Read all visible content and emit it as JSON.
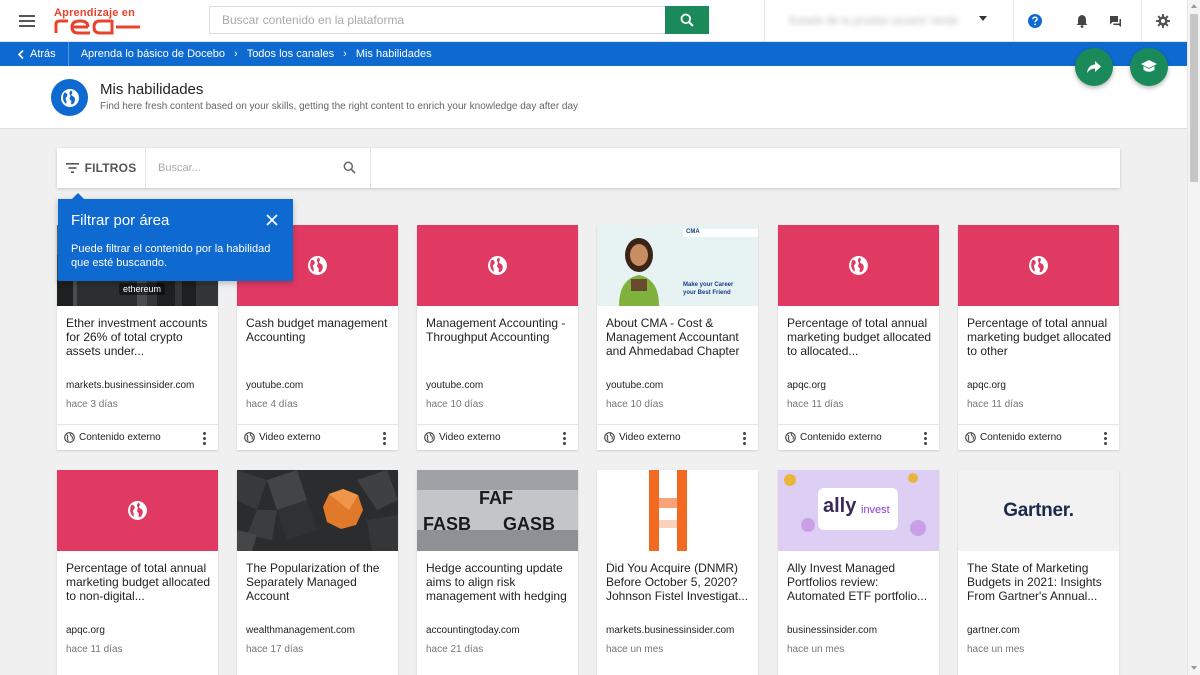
{
  "app": {
    "logo_text": "Aprendizaje en",
    "logo_word": "red",
    "search_placeholder": "Buscar contenido en la plataforma",
    "user_name": "Estado de la prueba usuario Verde"
  },
  "breadcrumb": {
    "back_label": "Atrás",
    "items": [
      "Aprenda lo básico de Docebo",
      "Todos los canales",
      "Mis habilidades"
    ]
  },
  "header": {
    "title": "Mis habilidades",
    "subtitle": "Find here fresh content based on your skills, getting the right content to enrich your knowledge day after day"
  },
  "filters": {
    "button_label": "FILTROS",
    "search_placeholder": "Buscar..."
  },
  "tooltip": {
    "title": "Filtrar por área",
    "body": "Puede filtrar el contenido por la habilidad que esté buscando."
  },
  "cards_row1": [
    {
      "title": "Ether investment accounts for 26% of total crypto assets under...",
      "source": "markets.businessinsider.com",
      "date": "hace 3 días",
      "type": "Contenido externo",
      "thumb": "ethereum-photo",
      "thumb_text": "ethereum"
    },
    {
      "title": "Cash budget management Accounting",
      "source": "youtube.com",
      "date": "hace 4 días",
      "type": "Video externo",
      "thumb": "globe-pink"
    },
    {
      "title": "Management Accounting - Throughput Accounting",
      "source": "youtube.com",
      "date": "hace 10 días",
      "type": "Video externo",
      "thumb": "globe-pink"
    },
    {
      "title": "About CMA - Cost & Management Accountant and Ahmedabad Chapter",
      "source": "youtube.com",
      "date": "hace 10 días",
      "type": "Video externo",
      "thumb": "cma-photo",
      "thumb_text": "Make your Career your Best Friend",
      "thumb_badge": "CMA"
    },
    {
      "title": "Percentage of total annual marketing budget allocated to allocated...",
      "source": "apqc.org",
      "date": "hace 11 días",
      "type": "Contenido externo",
      "thumb": "globe-pink"
    },
    {
      "title": "Percentage of total annual marketing budget allocated to other",
      "source": "apqc.org",
      "date": "hace 11 días",
      "type": "Contenido externo",
      "thumb": "globe-pink"
    }
  ],
  "cards_row2": [
    {
      "title": "Percentage of total annual marketing budget allocated to non-digital...",
      "source": "apqc.org",
      "date": "hace 11 días",
      "thumb": "globe-pink"
    },
    {
      "title": "The Popularization of the Separately Managed Account",
      "source": "wealthmanagement.com",
      "date": "hace 17 días",
      "thumb": "octagon-photo"
    },
    {
      "title": "Hedge accounting update aims to align risk management with hedging",
      "source": "accountingtoday.com",
      "date": "hace 21 días",
      "thumb": "fasb-gasb-photo",
      "thumb_text_1": "FAF",
      "thumb_text_2": "FASB",
      "thumb_text_3": "GASB"
    },
    {
      "title": "Did You Acquire (DNMR) Before October 5, 2020? Johnson Fistel Investigat...",
      "source": "markets.businessinsider.com",
      "date": "hace un mes",
      "thumb": "orange-bars"
    },
    {
      "title": "Ally Invest Managed Portfolios review: Automated ETF portfolio...",
      "source": "businessinsider.com",
      "date": "hace un mes",
      "thumb": "ally-invest",
      "thumb_text_1": "ally",
      "thumb_text_2": "invest"
    },
    {
      "title": "The State of Marketing Budgets in 2021: Insights From Gartner's Annual...",
      "source": "gartner.com",
      "date": "hace un mes",
      "thumb": "gartner-logo",
      "thumb_text": "Gartner."
    }
  ],
  "colors": {
    "brand_blue": "#0e6ad0",
    "brand_green": "#1a8a5a",
    "thumb_pink": "#e03a63",
    "logo_red": "#e8432c"
  }
}
